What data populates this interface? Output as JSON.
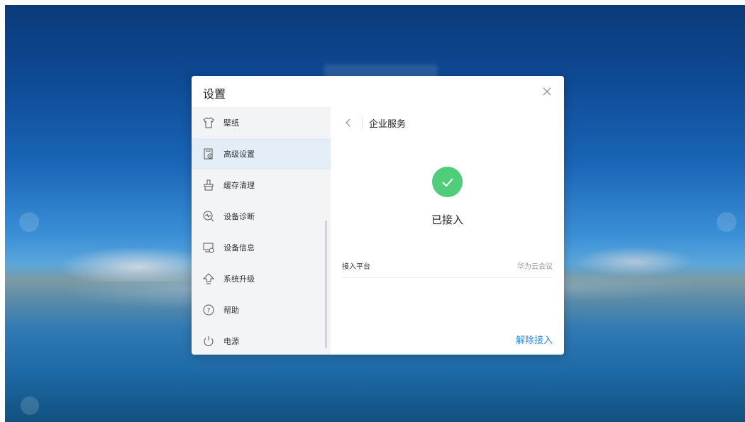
{
  "dialog": {
    "title": "设置"
  },
  "sidebar": {
    "items": [
      {
        "label": "壁纸",
        "icon": "shirt-icon",
        "active": false
      },
      {
        "label": "高级设置",
        "icon": "advanced-settings-icon",
        "active": true
      },
      {
        "label": "缓存清理",
        "icon": "clean-brush-icon",
        "active": false
      },
      {
        "label": "设备诊断",
        "icon": "diagnosis-icon",
        "active": false
      },
      {
        "label": "设备信息",
        "icon": "device-info-icon",
        "active": false
      },
      {
        "label": "系统升级",
        "icon": "upgrade-arrow-icon",
        "active": false
      },
      {
        "label": "帮助",
        "icon": "help-icon",
        "active": false
      },
      {
        "label": "电源",
        "icon": "power-icon",
        "active": false
      }
    ]
  },
  "content": {
    "title": "企业服务",
    "status": "已接入",
    "platform_label": "接入平台",
    "platform_value": "华为云会议",
    "disconnect_label": "解除接入"
  },
  "colors": {
    "accent": "#2a8be6",
    "success": "#4fcd79",
    "active_item_bg": "#e3edf8",
    "sidebar_bg": "#f3f4f6"
  }
}
